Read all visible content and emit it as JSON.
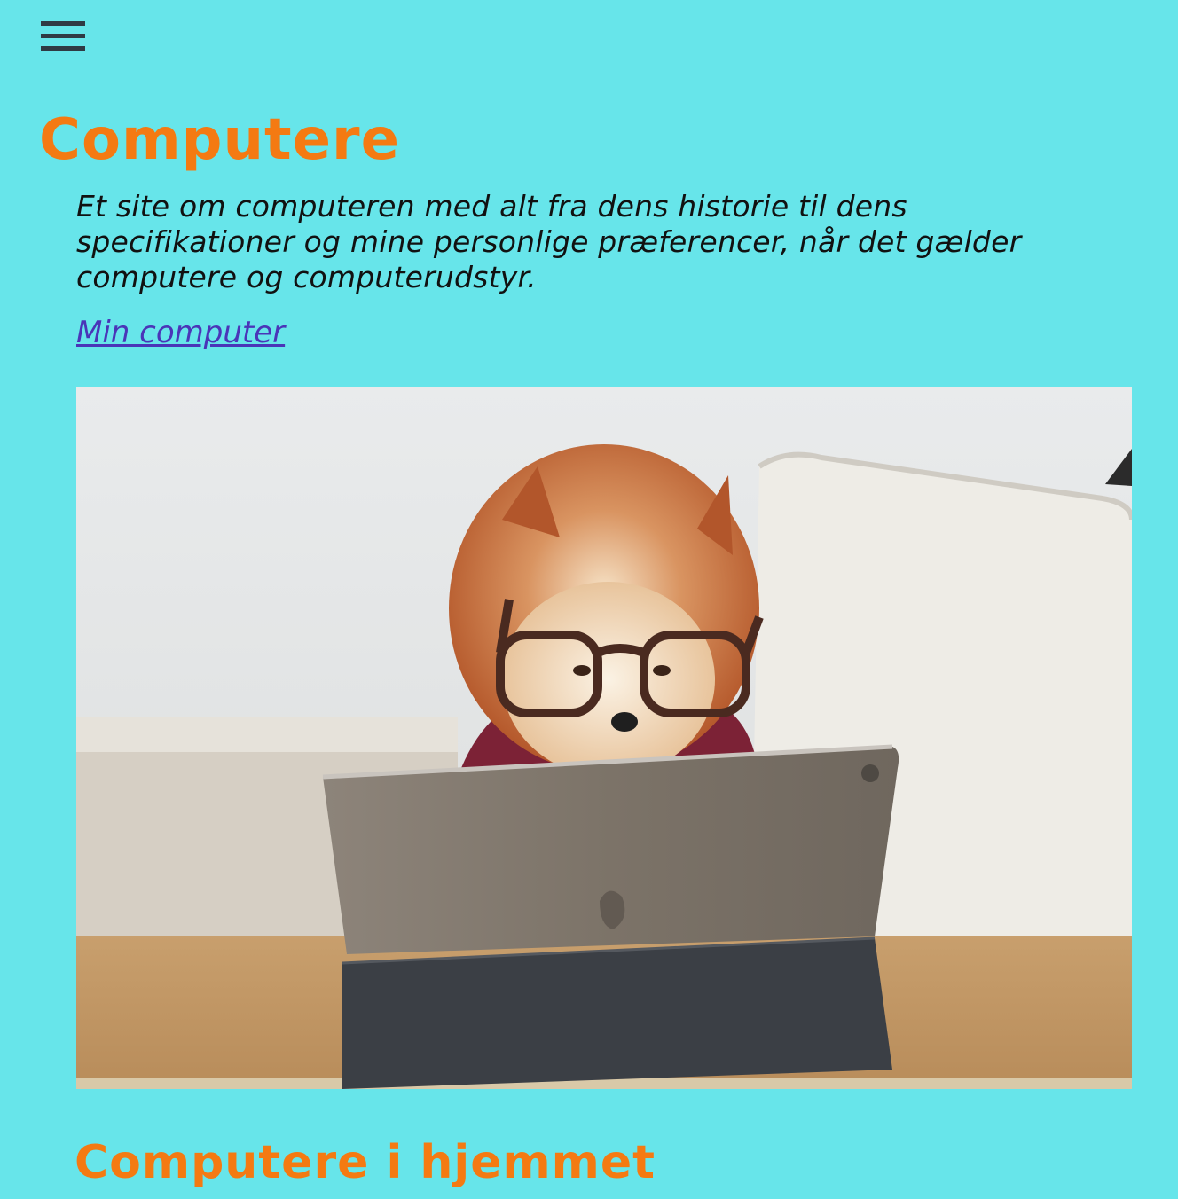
{
  "nav": {
    "menu_icon": "hamburger-menu-icon"
  },
  "header": {
    "title": "Computere",
    "intro": "Et site om computeren med alt fra dens historie til dens specifikationer og mine personlige præferencer, når det gælder computere og computerudstyr.",
    "link_label": "Min computer"
  },
  "hero_image": {
    "subject": "pomeranian-dog-with-glasses-using-tablet"
  },
  "sections": [
    {
      "heading": "Computere i hjemmet"
    }
  ],
  "colors": {
    "background": "#67e5ea",
    "heading": "#f47a12",
    "text": "#111111",
    "link": "#4a35b8",
    "menu_icon": "#2f3a44"
  }
}
